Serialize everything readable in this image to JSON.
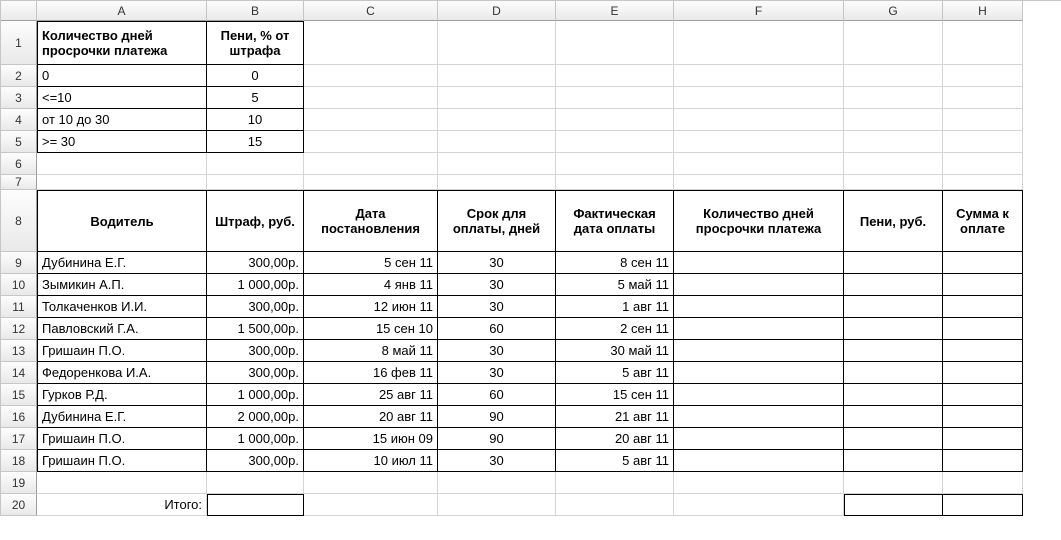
{
  "columns": [
    "A",
    "B",
    "C",
    "D",
    "E",
    "F",
    "G",
    "H"
  ],
  "rows": [
    "1",
    "2",
    "3",
    "4",
    "5",
    "6",
    "7",
    "8",
    "9",
    "10",
    "11",
    "12",
    "13",
    "14",
    "15",
    "16",
    "17",
    "18",
    "19",
    "20"
  ],
  "penalty_table": {
    "header_days": "Количество дней просрочки платежа",
    "header_pct": "Пени, % от штрафа",
    "rows": [
      {
        "days": "0",
        "pct": "0"
      },
      {
        "days": "<=10",
        "pct": "5"
      },
      {
        "days": "от 10 до 30",
        "pct": "10"
      },
      {
        "days": ">= 30",
        "pct": "15"
      }
    ]
  },
  "main_header": {
    "driver": "Водитель",
    "fine": "Штраф, руб.",
    "order_date": "Дата постановления",
    "pay_period": "Срок для оплаты, дней",
    "actual_date": "Фактическая дата оплаты",
    "overdue_days": "Количество дней просрочки платежа",
    "penalty": "Пени, руб.",
    "total": "Сумма к оплате"
  },
  "drivers": [
    {
      "name": "Дубинина Е.Г.",
      "fine": "300,00р.",
      "order": "5 сен 11",
      "period": "30",
      "actual": "8 сен 11"
    },
    {
      "name": "Зымикин А.П.",
      "fine": "1 000,00р.",
      "order": "4 янв 11",
      "period": "30",
      "actual": "5 май 11"
    },
    {
      "name": "Толкаченков И.И.",
      "fine": "300,00р.",
      "order": "12 июн 11",
      "period": "30",
      "actual": "1 авг 11"
    },
    {
      "name": "Павловский Г.А.",
      "fine": "1 500,00р.",
      "order": "15 сен 10",
      "period": "60",
      "actual": "2 сен 11"
    },
    {
      "name": "Гришаин П.О.",
      "fine": "300,00р.",
      "order": "8 май 11",
      "period": "30",
      "actual": "30 май 11"
    },
    {
      "name": "Федоренкова И.А.",
      "fine": "300,00р.",
      "order": "16 фев 11",
      "period": "30",
      "actual": "5 авг 11"
    },
    {
      "name": "Гурков Р.Д.",
      "fine": "1 000,00р.",
      "order": "25 авг 11",
      "period": "60",
      "actual": "15 сен 11"
    },
    {
      "name": "Дубинина Е.Г.",
      "fine": "2 000,00р.",
      "order": "20 авг 11",
      "period": "90",
      "actual": "21 авг 11"
    },
    {
      "name": "Гришаин П.О.",
      "fine": "1 000,00р.",
      "order": "15 июн 09",
      "period": "90",
      "actual": "20 авг 11"
    },
    {
      "name": "Гришаин П.О.",
      "fine": "300,00р.",
      "order": "10 июл 11",
      "period": "30",
      "actual": "5 авг 11"
    }
  ],
  "totals_label": "Итого:"
}
